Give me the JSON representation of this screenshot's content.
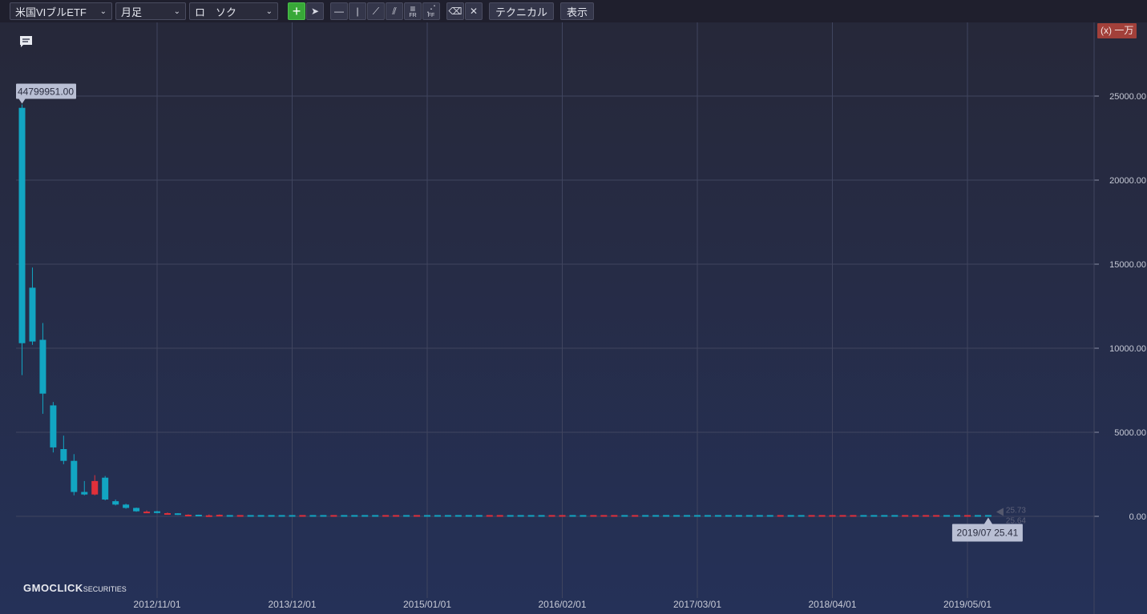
{
  "toolbar": {
    "symbol": "米国VIブルETF",
    "period": "月足",
    "chart_type": "ロ　ソク",
    "tools": [
      {
        "name": "crosshair-icon",
        "label": "+"
      },
      {
        "name": "pointer-icon",
        "label": "➤"
      },
      {
        "name": "horizontal-line-icon",
        "label": "—"
      },
      {
        "name": "vertical-line-icon",
        "label": "|"
      },
      {
        "name": "trend-line-icon",
        "label": "⟋"
      },
      {
        "name": "parallel-lines-icon",
        "label": "⫽"
      },
      {
        "name": "fibonacci-retracement-icon",
        "label": "≡",
        "sub": "FR"
      },
      {
        "name": "fibonacci-fan-icon",
        "label": "⋰",
        "sub": "FF"
      },
      {
        "name": "eraser-icon",
        "label": "⌫"
      },
      {
        "name": "erase-all-icon",
        "label": "✕"
      }
    ],
    "technical_label": "テクニカル",
    "display_label": "表示"
  },
  "unit_badge": "(x) 一万",
  "logo_main": "GMOCLICK",
  "logo_sub": "SECURITIES",
  "colors": {
    "up": "#12a5c2",
    "down": "#e0303a",
    "grid": "#40455f",
    "label_bg": "#b9bfd4"
  },
  "chart_data": {
    "type": "candlestick",
    "y_unit_multiplier": 10000,
    "ylim": [
      -4500,
      27400
    ],
    "y_ticks": [
      0,
      5000,
      10000,
      15000,
      20000,
      25000
    ],
    "y_tick_labels": [
      "0.00",
      "5000.00",
      "10000.00",
      "15000.00",
      "20000.00",
      "25000.00"
    ],
    "x_ticks": [
      "2012/11/01",
      "2013/12/01",
      "2015/01/01",
      "2016/02/01",
      "2017/03/01",
      "2018/04/01",
      "2019/05/01"
    ],
    "x_start": "2011/10",
    "x_end": "2019/07",
    "max_label": "44799951.00",
    "last_label": "2019/07 25.41",
    "right_labels": [
      "25.73",
      "25.64"
    ],
    "candles": [
      {
        "t": "2011/10",
        "o": 10300,
        "h": 24500,
        "l": 8400,
        "c": 24300
      },
      {
        "t": "2011/11",
        "o": 10400,
        "h": 14800,
        "l": 10200,
        "c": 13600
      },
      {
        "t": "2011/12",
        "o": 7300,
        "h": 11500,
        "l": 6100,
        "c": 10500
      },
      {
        "t": "2012/01",
        "o": 4100,
        "h": 6800,
        "l": 3800,
        "c": 6600
      },
      {
        "t": "2012/02",
        "o": 3300,
        "h": 4800,
        "l": 3100,
        "c": 4000
      },
      {
        "t": "2012/03",
        "o": 1450,
        "h": 3700,
        "l": 1250,
        "c": 3300
      },
      {
        "t": "2012/04",
        "o": 1300,
        "h": 2100,
        "l": 1250,
        "c": 1450
      },
      {
        "t": "2012/05",
        "o": 2100,
        "h": 2450,
        "l": 1250,
        "c": 1300
      },
      {
        "t": "2012/06",
        "o": 1000,
        "h": 2400,
        "l": 950,
        "c": 2300
      },
      {
        "t": "2012/07",
        "o": 700,
        "h": 1000,
        "l": 650,
        "c": 900
      },
      {
        "t": "2012/08",
        "o": 500,
        "h": 750,
        "l": 450,
        "c": 700
      },
      {
        "t": "2012/09",
        "o": 300,
        "h": 520,
        "l": 270,
        "c": 500
      },
      {
        "t": "2012/10",
        "o": 280,
        "h": 350,
        "l": 230,
        "c": 250
      },
      {
        "t": "2012/11",
        "o": 200,
        "h": 330,
        "l": 180,
        "c": 300
      },
      {
        "t": "2012/12",
        "o": 190,
        "h": 230,
        "l": 150,
        "c": 160
      },
      {
        "t": "2013/01",
        "o": 100,
        "h": 190,
        "l": 80,
        "c": 180
      },
      {
        "t": "2013/02",
        "o": 95,
        "h": 120,
        "l": 70,
        "c": 80
      },
      {
        "t": "2013/03",
        "o": 55,
        "h": 100,
        "l": 45,
        "c": 95
      },
      {
        "t": "2013/04",
        "o": 60,
        "h": 110,
        "l": 50,
        "c": 55
      },
      {
        "t": "2013/05",
        "o": 90,
        "h": 110,
        "l": 50,
        "c": 60
      }
    ],
    "tail_from": "2013/06",
    "tail_value": 26,
    "tail_down_months": [
      "2013/07",
      "2014/01",
      "2014/04",
      "2014/09",
      "2014/10",
      "2014/12",
      "2015/07",
      "2015/08",
      "2016/01",
      "2016/02",
      "2016/05",
      "2016/06",
      "2016/07",
      "2016/09",
      "2017/11",
      "2018/02",
      "2018/03",
      "2018/04",
      "2018/05",
      "2018/06",
      "2018/11",
      "2018/12",
      "2019/01",
      "2019/02",
      "2019/05"
    ]
  }
}
